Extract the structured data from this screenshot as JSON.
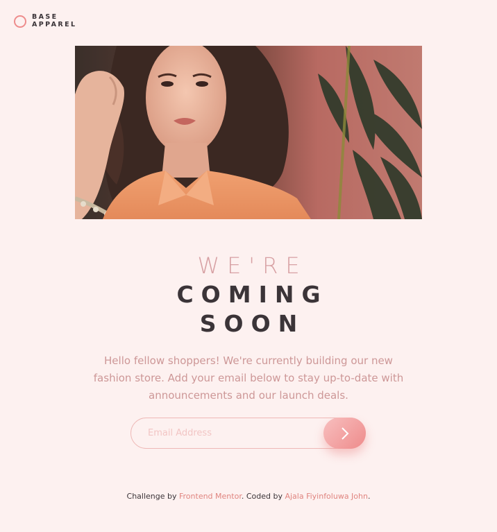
{
  "brand": {
    "line1": "BASE",
    "line2": "APPAREL",
    "accent": "#ee8c8c"
  },
  "hero": {
    "icon": "hero-photo-woman-in-peach-shirt"
  },
  "heading": {
    "light": "WE'RE",
    "dark_line1": "COMING",
    "dark_line2": "SOON"
  },
  "description": "Hello fellow shoppers! We're currently building our new fashion store. Add your email below to stay up-to-date with announcements and our launch deals.",
  "form": {
    "email_placeholder": "Email Address",
    "email_value": "",
    "submit_icon": "chevron-right-icon"
  },
  "footer": {
    "prefix": "Challenge by ",
    "link1": "Frontend Mentor",
    "middle": ". Coded by ",
    "link2": "Ajala Fiyinfoluwa John",
    "suffix": "."
  },
  "colors": {
    "background": "#fdf1f0",
    "text_dark": "#3b3438",
    "text_muted": "#cd9797",
    "link": "#e0847f"
  }
}
